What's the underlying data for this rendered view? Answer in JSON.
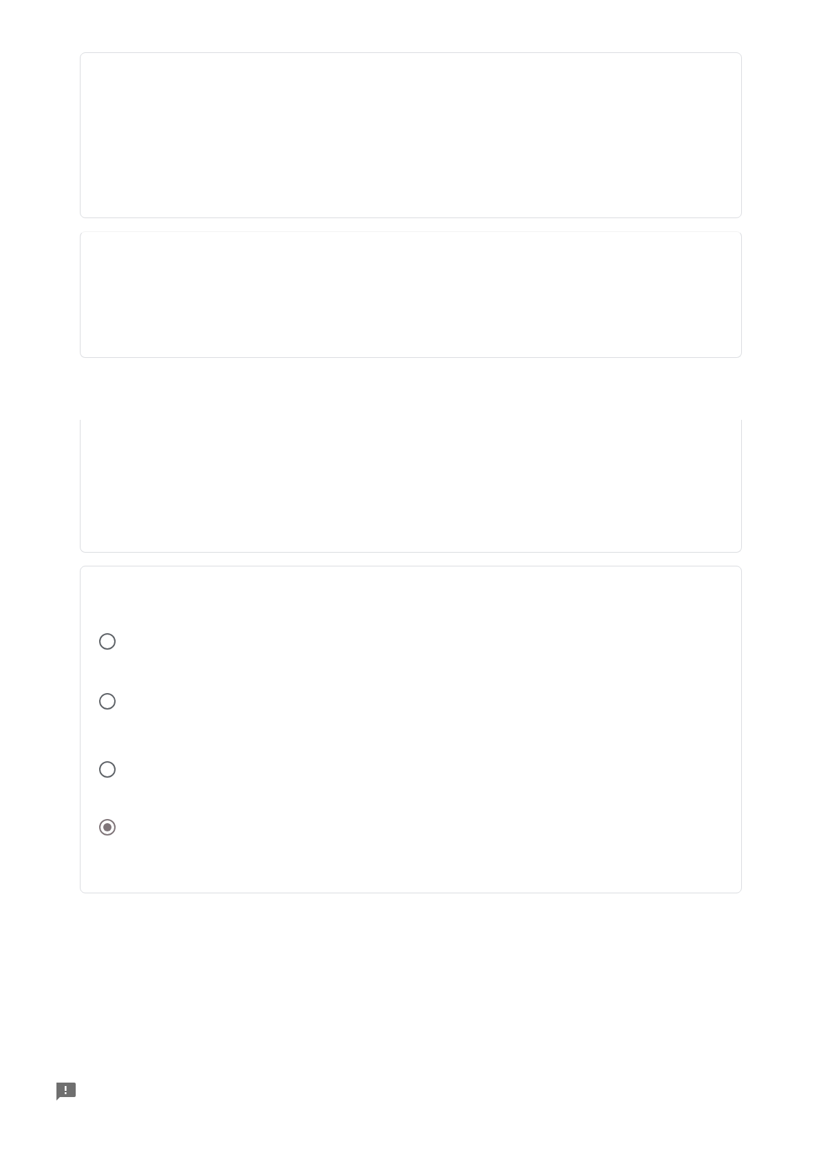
{
  "question": {
    "options": [
      {
        "selected": false
      },
      {
        "selected": false
      },
      {
        "selected": false
      },
      {
        "selected": true
      }
    ]
  }
}
